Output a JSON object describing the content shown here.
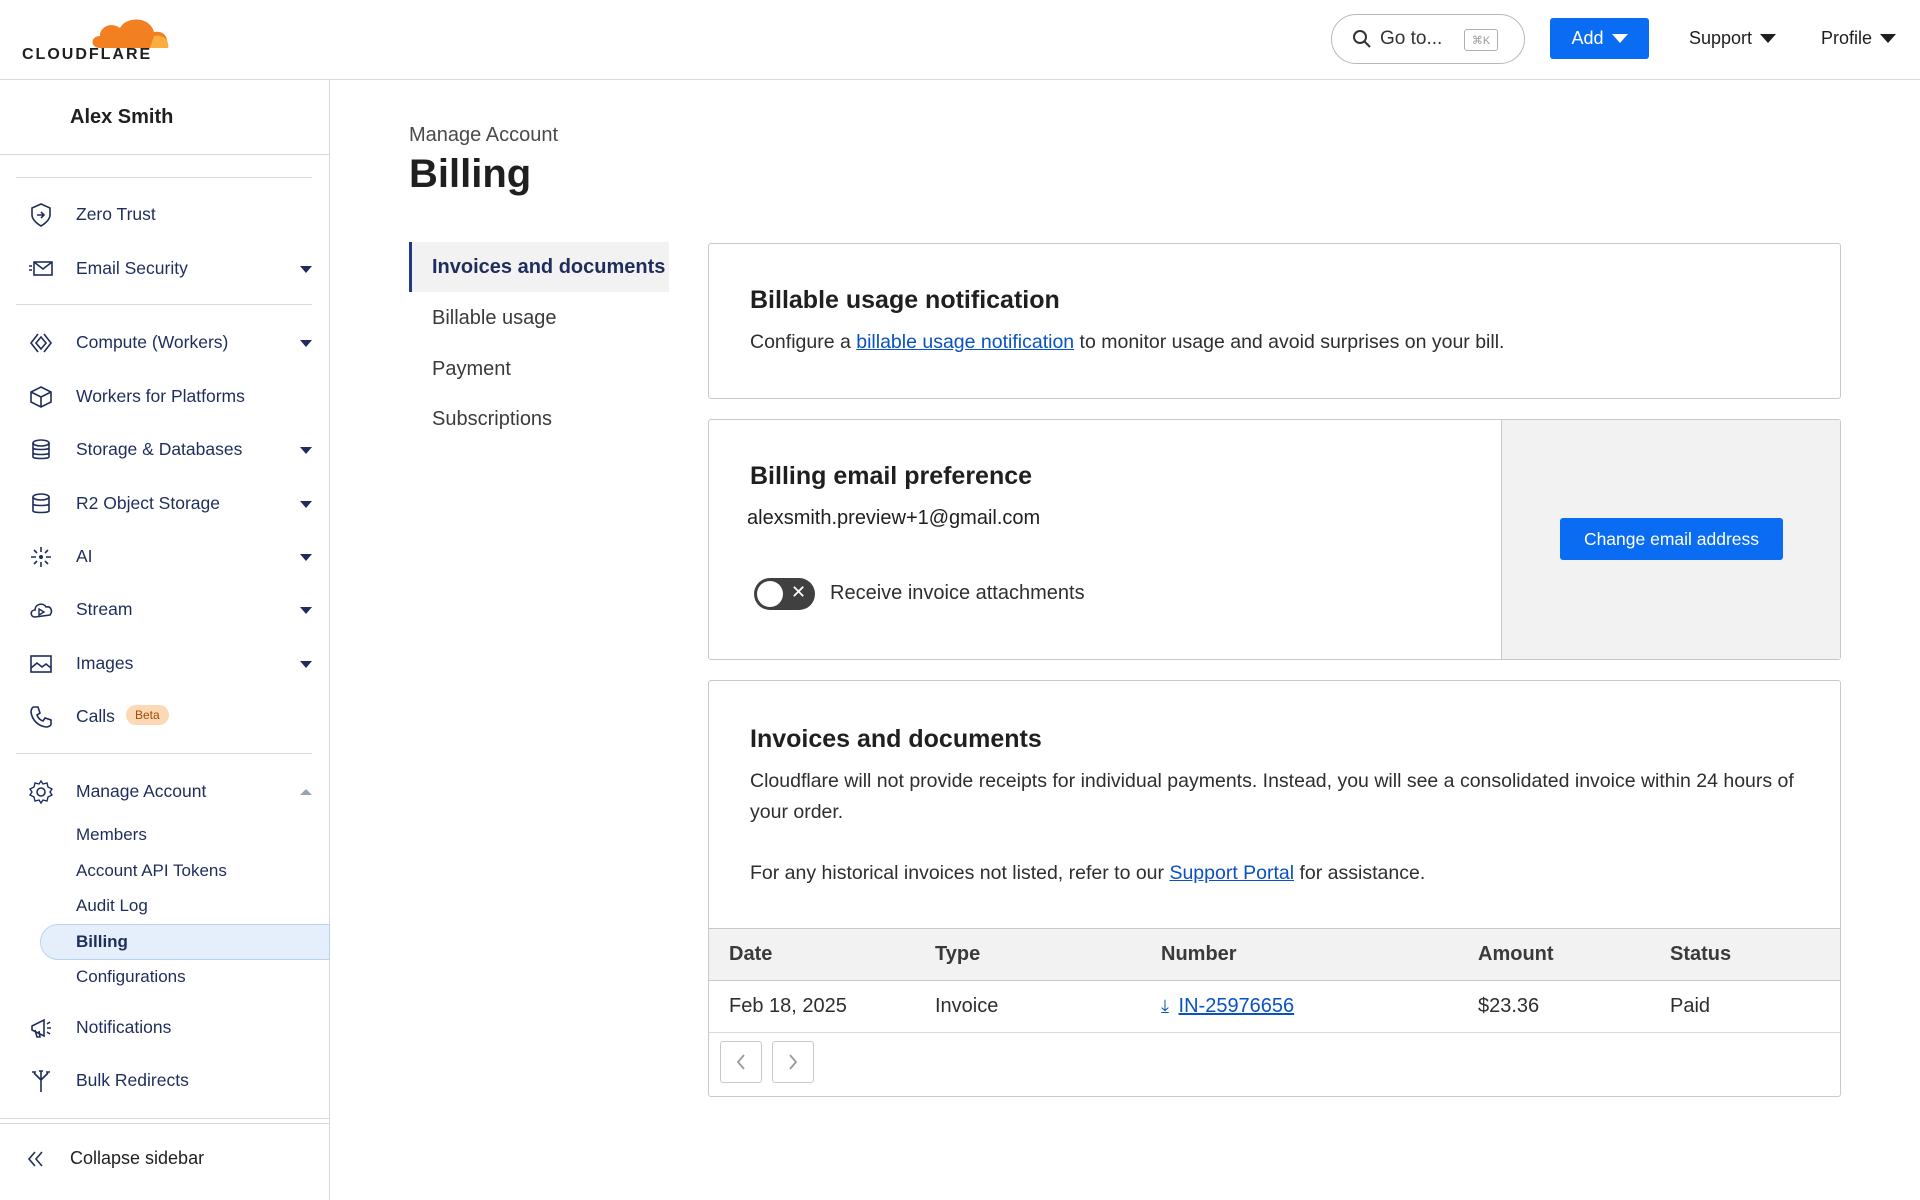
{
  "brand": {
    "name": "CLOUDFLARE",
    "accent": "#f38020",
    "primary": "#0a6cf2"
  },
  "topbar": {
    "goto_label": "Go to...",
    "goto_shortcut": "⌘K",
    "add_label": "Add",
    "support_label": "Support",
    "profile_label": "Profile"
  },
  "sidebar": {
    "account_name": "Alex Smith",
    "items": [
      {
        "label": "Zero Trust",
        "icon": "zero-trust-icon"
      },
      {
        "label": "Email Security",
        "icon": "email-security-icon"
      },
      {
        "label": "Compute (Workers)",
        "icon": "workers-icon"
      },
      {
        "label": "Workers for Platforms",
        "icon": "cube-icon"
      },
      {
        "label": "Storage & Databases",
        "icon": "database-icon"
      },
      {
        "label": "R2 Object Storage",
        "icon": "storage-icon"
      },
      {
        "label": "AI",
        "icon": "sparkle-icon"
      },
      {
        "label": "Stream",
        "icon": "cloud-play-icon"
      },
      {
        "label": "Images",
        "icon": "image-icon"
      },
      {
        "label": "Calls",
        "icon": "phone-icon",
        "badge": "Beta"
      },
      {
        "label": "Manage Account",
        "icon": "gear-icon"
      },
      {
        "label": "Notifications",
        "icon": "megaphone-icon"
      },
      {
        "label": "Bulk Redirects",
        "icon": "redirect-icon"
      }
    ],
    "manage_account_sub": [
      "Members",
      "Account API Tokens",
      "Audit Log",
      "Billing",
      "Configurations"
    ],
    "collapse_label": "Collapse sidebar"
  },
  "main": {
    "breadcrumb": "Manage Account",
    "title": "Billing",
    "subnav": [
      "Invoices and documents",
      "Billable usage",
      "Payment",
      "Subscriptions"
    ],
    "usage_card": {
      "title": "Billable usage notification",
      "text_before": "Configure a ",
      "link": "billable usage notification",
      "text_after": " to monitor usage and avoid surprises on your bill."
    },
    "email_card": {
      "title": "Billing email preference",
      "email": "alexsmith.preview+1@gmail.com",
      "toggle_label": "Receive invoice attachments",
      "toggle_on": false,
      "button_label": "Change email address"
    },
    "invoices_card": {
      "title": "Invoices and documents",
      "text1": "Cloudflare will not provide receipts for individual payments. Instead, you will see a consolidated invoice within 24 hours of your order.",
      "text2_before": "For any historical invoices not listed, refer to our ",
      "text2_link": "Support Portal",
      "text2_after": " for assistance.",
      "columns": [
        "Date",
        "Type",
        "Number",
        "Amount",
        "Status"
      ],
      "rows": [
        {
          "date": "Feb 18, 2025",
          "type": "Invoice",
          "number": "IN-25976656",
          "amount": "$23.36",
          "status": "Paid"
        }
      ]
    }
  }
}
